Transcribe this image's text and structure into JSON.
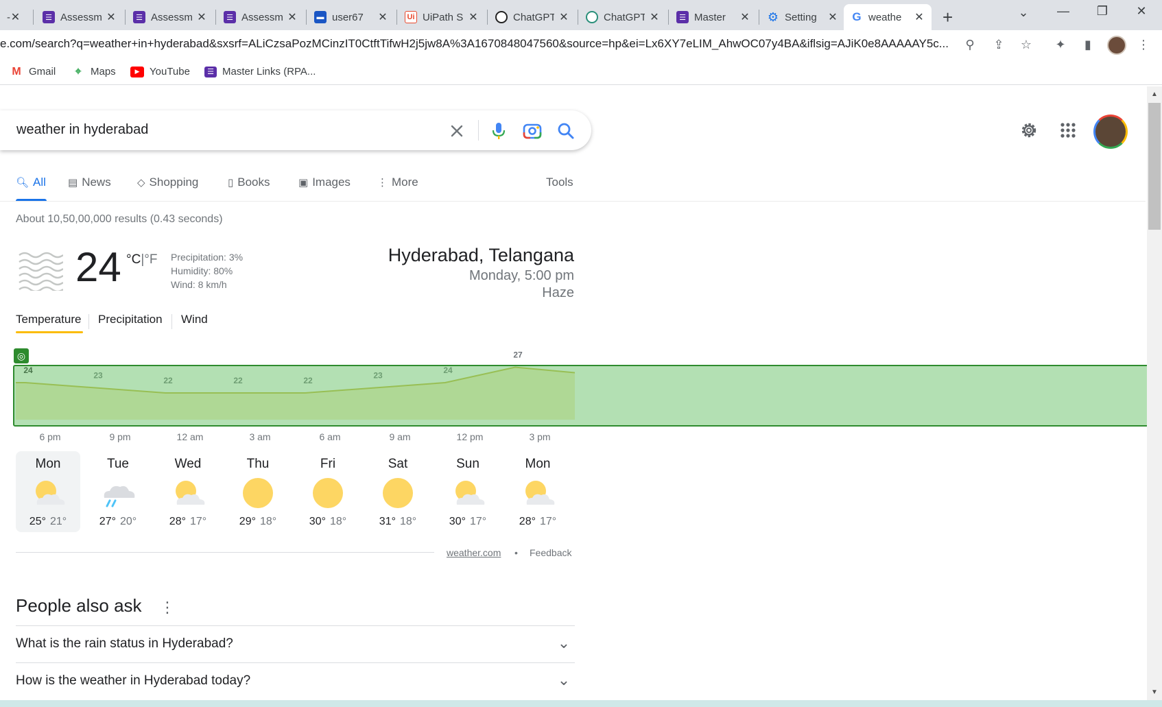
{
  "tabs": [
    {
      "title": "",
      "icon": "chevron-partial-icon"
    },
    {
      "title": "Assessm",
      "icon": "form-icon"
    },
    {
      "title": "Assessm",
      "icon": "form-icon"
    },
    {
      "title": "Assessm",
      "icon": "form-icon"
    },
    {
      "title": "user67",
      "icon": "card-icon"
    },
    {
      "title": "UiPath S",
      "icon": "uipath-icon"
    },
    {
      "title": "ChatGPT",
      "icon": "openai-icon"
    },
    {
      "title": "ChatGPT",
      "icon": "openai-icon"
    },
    {
      "title": "Master",
      "icon": "form-icon"
    },
    {
      "title": "Setting",
      "icon": "gear-icon"
    },
    {
      "title": "weathe",
      "icon": "google-icon"
    }
  ],
  "address": {
    "url": "e.com/search?q=weather+in+hyderabad&sxsrf=ALiCzsaPozMCinzIT0CtftTifwH2j5jw8A%3A1670848047560&source=hp&ei=Lx6XY7eLIM_AhwOC07y4BA&iflsig=AJiK0e8AAAAAY5c..."
  },
  "bookmarks": [
    {
      "label": "Gmail"
    },
    {
      "label": "Maps"
    },
    {
      "label": "YouTube"
    },
    {
      "label": "Master Links (RPA..."
    }
  ],
  "search": {
    "query": "weather in hyderabad"
  },
  "nav": {
    "all": "All",
    "news": "News",
    "shopping": "Shopping",
    "books": "Books",
    "images": "Images",
    "more": "More",
    "tools": "Tools"
  },
  "stats": "About 10,50,00,000 results (0.43 seconds)",
  "weather": {
    "temp": "24",
    "unit_c": "°C",
    "unit_sep": "|",
    "unit_f": "°F",
    "precipitation": "Precipitation: 3%",
    "humidity": "Humidity: 80%",
    "wind": "Wind: 8 km/h",
    "location": "Hyderabad, Telangana",
    "time": "Monday, 5:00 pm",
    "condition": "Haze",
    "tabs": [
      "Temperature",
      "Precipitation",
      "Wind"
    ],
    "source": "weather.com",
    "separator": "•",
    "feedback": "Feedback"
  },
  "chart_data": {
    "type": "area",
    "x": [
      "6 pm",
      "9 pm",
      "12 am",
      "3 am",
      "6 am",
      "9 am",
      "12 pm",
      "3 pm"
    ],
    "values": [
      24,
      23,
      22,
      22,
      22,
      23,
      24,
      27
    ],
    "xlabels": [
      "6 pm",
      "9 pm",
      "12 am",
      "3 am",
      "6 am",
      "9 am",
      "12 pm",
      "3 pm"
    ],
    "line_color": "#c7ba3a",
    "fill_color": "#f6efc0"
  },
  "forecast": [
    {
      "day": "Mon",
      "hi": "25°",
      "lo": "21°",
      "icon": "partly-cloudy-icon"
    },
    {
      "day": "Tue",
      "hi": "27°",
      "lo": "20°",
      "icon": "rain-cloud-icon"
    },
    {
      "day": "Wed",
      "hi": "28°",
      "lo": "17°",
      "icon": "partly-cloudy-icon"
    },
    {
      "day": "Thu",
      "hi": "29°",
      "lo": "18°",
      "icon": "sunny-icon"
    },
    {
      "day": "Fri",
      "hi": "30°",
      "lo": "18°",
      "icon": "sunny-icon"
    },
    {
      "day": "Sat",
      "hi": "31°",
      "lo": "18°",
      "icon": "sunny-icon"
    },
    {
      "day": "Sun",
      "hi": "30°",
      "lo": "17°",
      "icon": "partly-cloudy-icon"
    },
    {
      "day": "Mon",
      "hi": "28°",
      "lo": "17°",
      "icon": "partly-cloudy-icon"
    }
  ],
  "paa": {
    "title": "People also ask",
    "questions": [
      "What is the rain status in Hyderabad?",
      "How is the weather in Hyderabad today?"
    ]
  },
  "colors": {
    "google_blue": "#1a73e8",
    "highlight_green": "#2e8b2e",
    "temp_tab_underline": "#fbbc04"
  }
}
